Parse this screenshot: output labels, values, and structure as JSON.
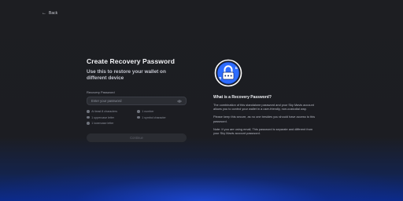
{
  "back": {
    "label": "Back"
  },
  "form": {
    "title": "Create Recovery Password",
    "subtitle": "Use this to restore your wallet on different device",
    "field_label": "Recovery Password",
    "placeholder": "Enter your password",
    "requirements": [
      "At least 8 characters",
      "1 number",
      "1 uppercase letter",
      "1 symbol character",
      "1 lowercase letter"
    ],
    "continue_label": "Continue"
  },
  "info": {
    "title": "What is a Recovery Password?",
    "paragraphs": [
      "The combination of this standalone password and your Sky Mavis account allows you to control your wallet in a user-friendly, non-custodial way.",
      "Please keep this secure, as no one besides you should have access to this password.",
      "Note: If you are using email, This password is separate and different from your Sky Mavis account password."
    ]
  },
  "colors": {
    "accent": "#2d6cff",
    "background": "#1d1e22",
    "glow": "#0b2a8a"
  }
}
